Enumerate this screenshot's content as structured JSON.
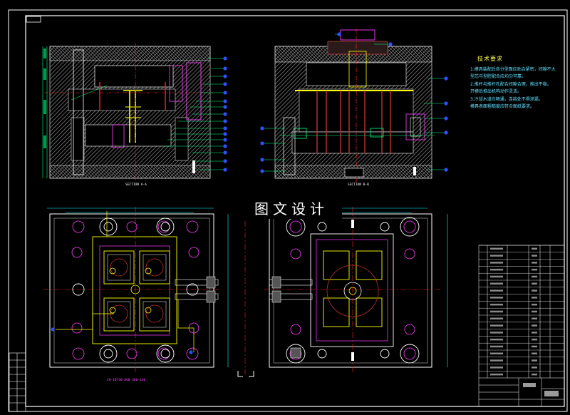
{
  "banner": {
    "text": "图文设计"
  },
  "tech_requirements": {
    "title": "技术要求",
    "lines": [
      "1.模具装配后各分型面应贴合紧密，间隙不大于规定值。",
      "  型芯与型腔配合应均匀可靠。",
      "2.推杆与推杆孔配合间隙合理，推出平稳。",
      "  开模后推出机构动作灵活。",
      "3.冷却水道应畅通，连接处不得渗漏。",
      "  模具表面粗糙度应符合图纸要求。"
    ]
  },
  "section_labels": {
    "left": "SECTION A-A",
    "right": "SECTION B-B"
  },
  "bottom_caption": "CH-ID730-A60-380-430",
  "colors": {
    "background": "#000000",
    "frame": "#ffffff",
    "plate_hatch": "#8a8a8a",
    "centerline": "#ff2020",
    "dimension": "#00ffff",
    "balloon": "#3050ff",
    "pin_yellow": "#ffff00",
    "bolt": "#ff40ff"
  }
}
